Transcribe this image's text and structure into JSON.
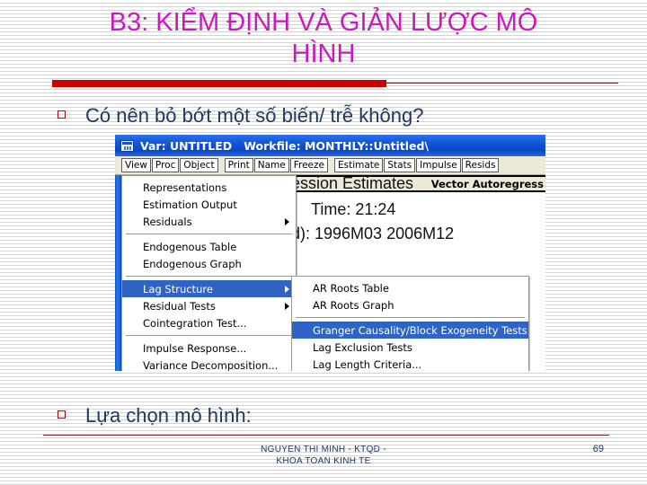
{
  "slide": {
    "title": "B3: KIỂM ĐỊNH VÀ GIẢN LƯỢC MÔ\nHÌNH",
    "bullets": [
      {
        "text": "Có nên bỏ bớt một số biến/ trễ không?"
      },
      {
        "text": "Lựa chọn mô hình:"
      }
    ],
    "footer": {
      "center_line1": "NGUYEN THI MINH - KTQD      -",
      "center_line2": "KHOA TOAN KINH TE",
      "page_number": "69"
    },
    "colors": {
      "title": "#CC19BE",
      "body_text": "#1F3864",
      "rule_red": "#CC0000",
      "bullet_marker": "#C00000"
    }
  },
  "eviews": {
    "titlebar": {
      "icon": "window-icon",
      "text": "Var: UNTITLED   Workfile: MONTHLY::Untitled\\"
    },
    "toolbar": {
      "group1": [
        "View",
        "Proc",
        "Object"
      ],
      "group2": [
        "Print",
        "Name",
        "Freeze"
      ],
      "group3": [
        "Estimate",
        "Stats",
        "Impulse",
        "Resids"
      ]
    },
    "background_output": {
      "header": "Vector Autoregress",
      "line1": "ession Estimates",
      "line2": "Time: 21:24",
      "line3": "d): 1996M03 2006M12"
    },
    "view_menu": {
      "groups": [
        [
          {
            "label": "Representations",
            "submenu": false
          },
          {
            "label": "Estimation Output",
            "submenu": false
          },
          {
            "label": "Residuals",
            "submenu": true
          }
        ],
        [
          {
            "label": "Endogenous Table",
            "submenu": false
          },
          {
            "label": "Endogenous Graph",
            "submenu": false
          }
        ],
        [
          {
            "label": "Lag Structure",
            "submenu": true,
            "selected": true
          },
          {
            "label": "Residual Tests",
            "submenu": true
          },
          {
            "label": "Cointegration Test...",
            "submenu": false
          }
        ],
        [
          {
            "label": "Impulse Response...",
            "submenu": false
          },
          {
            "label": "Variance Decomposition...",
            "submenu": false
          }
        ]
      ]
    },
    "lag_submenu": {
      "groups": [
        [
          {
            "label": "AR Roots Table",
            "submenu": false
          },
          {
            "label": "AR Roots Graph",
            "submenu": false
          }
        ],
        [
          {
            "label": "Granger Causality/Block Exogeneity Tests",
            "submenu": false,
            "selected": true
          },
          {
            "label": "Lag Exclusion Tests",
            "submenu": false
          },
          {
            "label": "Lag Length Criteria...",
            "submenu": false
          }
        ]
      ]
    },
    "colors": {
      "titlebar_blue": "#0B46C2",
      "menu_highlight": "#2F63C4",
      "toolbar_bg": "#ECE9D8"
    }
  }
}
